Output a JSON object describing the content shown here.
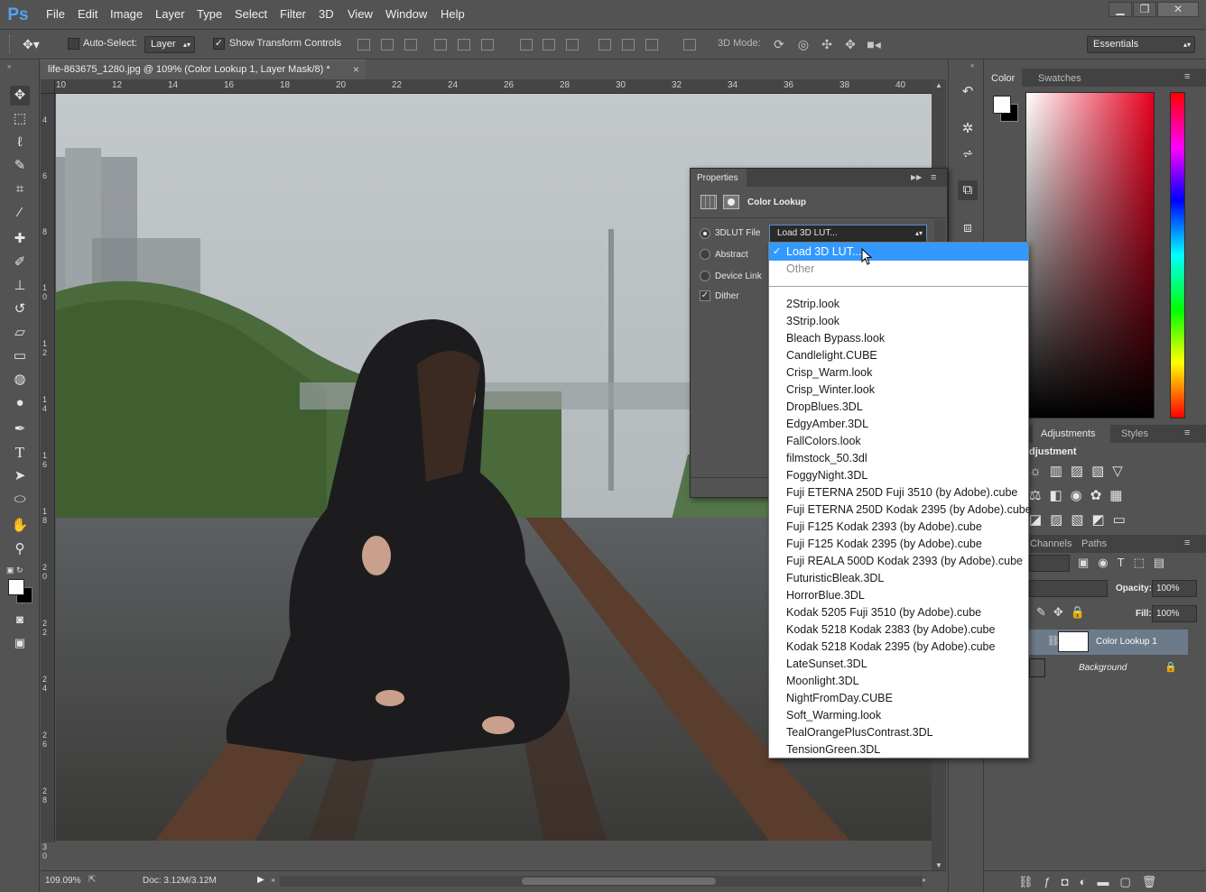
{
  "app": {
    "logo": "Ps"
  },
  "menu": [
    "File",
    "Edit",
    "Image",
    "Layer",
    "Type",
    "Select",
    "Filter",
    "3D",
    "View",
    "Window",
    "Help"
  ],
  "window_controls": {
    "minimize": "▁",
    "restore": "❐",
    "close": "✕"
  },
  "options_bar": {
    "auto_select_label": "Auto-Select:",
    "auto_select_value": "Layer",
    "show_transform_label": "Show Transform Controls",
    "mode_3d_label": "3D Mode:",
    "workspace": "Essentials"
  },
  "document": {
    "tab_title": "life-863675_1280.jpg @ 109% (Color Lookup 1, Layer Mask/8) *",
    "close": "×",
    "ruler_top": [
      "10",
      "12",
      "14",
      "16",
      "18",
      "20",
      "22",
      "24",
      "26",
      "28",
      "30",
      "32",
      "34",
      "36",
      "38",
      "40"
    ],
    "ruler_left": [
      "4",
      "6",
      "8",
      "1\n0",
      "1\n2",
      "1\n4",
      "1\n6",
      "1\n8",
      "2\n0",
      "2\n2",
      "2\n4",
      "2\n6",
      "2\n8",
      "3\n0"
    ]
  },
  "status": {
    "zoom": "109.09%",
    "doc": "Doc: 3.12M/3.12M"
  },
  "properties": {
    "title": "Properties",
    "panel_name": "Color Lookup",
    "options": [
      {
        "label": "3DLUT File",
        "selected": true
      },
      {
        "label": "Abstract",
        "selected": false
      },
      {
        "label": "Device Link",
        "selected": false
      }
    ],
    "dither_label": "Dither",
    "select_value": "Load 3D LUT..."
  },
  "dropdown": {
    "checked_item": "Load 3D LUT...",
    "other": "Other",
    "items": [
      "2Strip.look",
      "3Strip.look",
      "Bleach Bypass.look",
      "Candlelight.CUBE",
      "Crisp_Warm.look",
      "Crisp_Winter.look",
      "DropBlues.3DL",
      "EdgyAmber.3DL",
      "FallColors.look",
      "filmstock_50.3dl",
      "FoggyNight.3DL",
      "Fuji ETERNA 250D Fuji 3510 (by Adobe).cube",
      "Fuji ETERNA 250D Kodak 2395 (by Adobe).cube",
      "Fuji F125 Kodak 2393 (by Adobe).cube",
      "Fuji F125 Kodak 2395 (by Adobe).cube",
      "Fuji REALA 500D Kodak 2393 (by Adobe).cube",
      "FuturisticBleak.3DL",
      "HorrorBlue.3DL",
      "Kodak 5205 Fuji 3510 (by Adobe).cube",
      "Kodak 5218 Kodak 2383 (by Adobe).cube",
      "Kodak 5218 Kodak 2395 (by Adobe).cube",
      "LateSunset.3DL",
      "Moonlight.3DL",
      "NightFromDay.CUBE",
      "Soft_Warming.look",
      "TealOrangePlusContrast.3DL",
      "TensionGreen.3DL"
    ]
  },
  "right_panel": {
    "color_tabs": [
      "Color",
      "Swatches"
    ],
    "adjust_tabs": [
      "Adjustments",
      "Styles"
    ],
    "adjust_heading": "djustment",
    "layers_tabs": [
      "Channels",
      "Paths"
    ],
    "opacity_label": "Opacity:",
    "opacity_value": "100%",
    "fill_label": "Fill:",
    "fill_value": "100%",
    "layers": [
      {
        "name": "Color Lookup 1",
        "selected": true
      },
      {
        "name": "Background",
        "selected": false
      }
    ]
  },
  "colors": {
    "accent": "#3399ff",
    "panel": "#535353",
    "dark": "#3a3a3a"
  }
}
